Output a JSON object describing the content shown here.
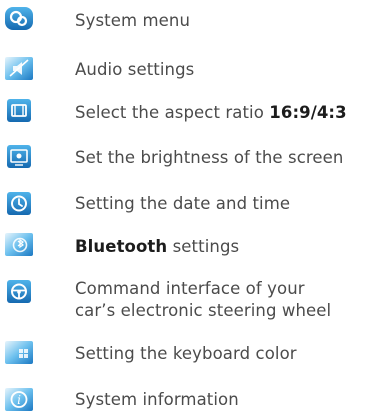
{
  "menu_items": [
    {
      "icon": "system-menu-icon",
      "text": "System menu"
    },
    {
      "icon": "speaker-muted-icon",
      "text": "Audio settings"
    },
    {
      "icon": "aspect-ratio-icon",
      "text_before": "Select the aspect ratio ",
      "text_bold": "16:9/4:3"
    },
    {
      "icon": "brightness-icon",
      "text": "Set the brightness of the screen"
    },
    {
      "icon": "clock-icon",
      "text": "Setting the date and time"
    },
    {
      "icon": "bluetooth-icon",
      "text_bold": "Bluetooth",
      "text_after": " settings"
    },
    {
      "icon": "steering-wheel-icon",
      "text_line1": "Command interface of your",
      "text_line2": "car’s electronic steering wheel"
    },
    {
      "icon": "keyboard-color-icon",
      "text": "Setting the keyboard color"
    },
    {
      "icon": "info-icon",
      "text": "System information"
    }
  ],
  "colors": {
    "icon_blue": "#1e7fc4",
    "icon_light": "#7cc4ee",
    "text": "#4b4b4b",
    "bold_text": "#1c1c1c"
  }
}
